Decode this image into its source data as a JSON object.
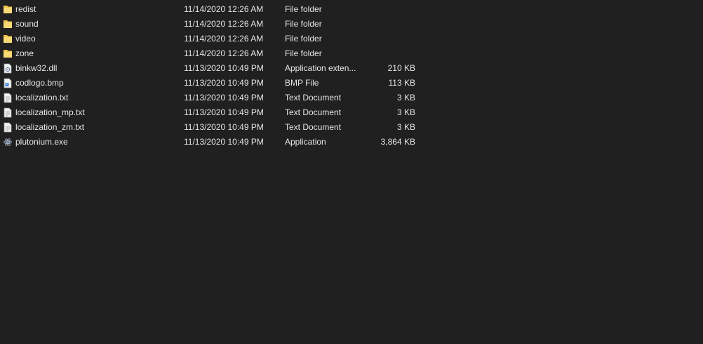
{
  "files": [
    {
      "name": "redist",
      "date": "11/14/2020 12:26 AM",
      "type": "File folder",
      "size": "",
      "icon": "folder-icon"
    },
    {
      "name": "sound",
      "date": "11/14/2020 12:26 AM",
      "type": "File folder",
      "size": "",
      "icon": "folder-icon"
    },
    {
      "name": "video",
      "date": "11/14/2020 12:26 AM",
      "type": "File folder",
      "size": "",
      "icon": "folder-icon"
    },
    {
      "name": "zone",
      "date": "11/14/2020 12:26 AM",
      "type": "File folder",
      "size": "",
      "icon": "folder-icon"
    },
    {
      "name": "binkw32.dll",
      "date": "11/13/2020 10:49 PM",
      "type": "Application exten...",
      "size": "210 KB",
      "icon": "dll-file-icon"
    },
    {
      "name": "codlogo.bmp",
      "date": "11/13/2020 10:49 PM",
      "type": "BMP File",
      "size": "113 KB",
      "icon": "bmp-file-icon"
    },
    {
      "name": "localization.txt",
      "date": "11/13/2020 10:49 PM",
      "type": "Text Document",
      "size": "3 KB",
      "icon": "text-file-icon"
    },
    {
      "name": "localization_mp.txt",
      "date": "11/13/2020 10:49 PM",
      "type": "Text Document",
      "size": "3 KB",
      "icon": "text-file-icon"
    },
    {
      "name": "localization_zm.txt",
      "date": "11/13/2020 10:49 PM",
      "type": "Text Document",
      "size": "3 KB",
      "icon": "text-file-icon"
    },
    {
      "name": "plutonium.exe",
      "date": "11/13/2020 10:49 PM",
      "type": "Application",
      "size": "3,864 KB",
      "icon": "atom-app-icon"
    }
  ],
  "colors": {
    "background": "#202020",
    "text": "#e6e6e6",
    "folder": "#f3c74f"
  }
}
